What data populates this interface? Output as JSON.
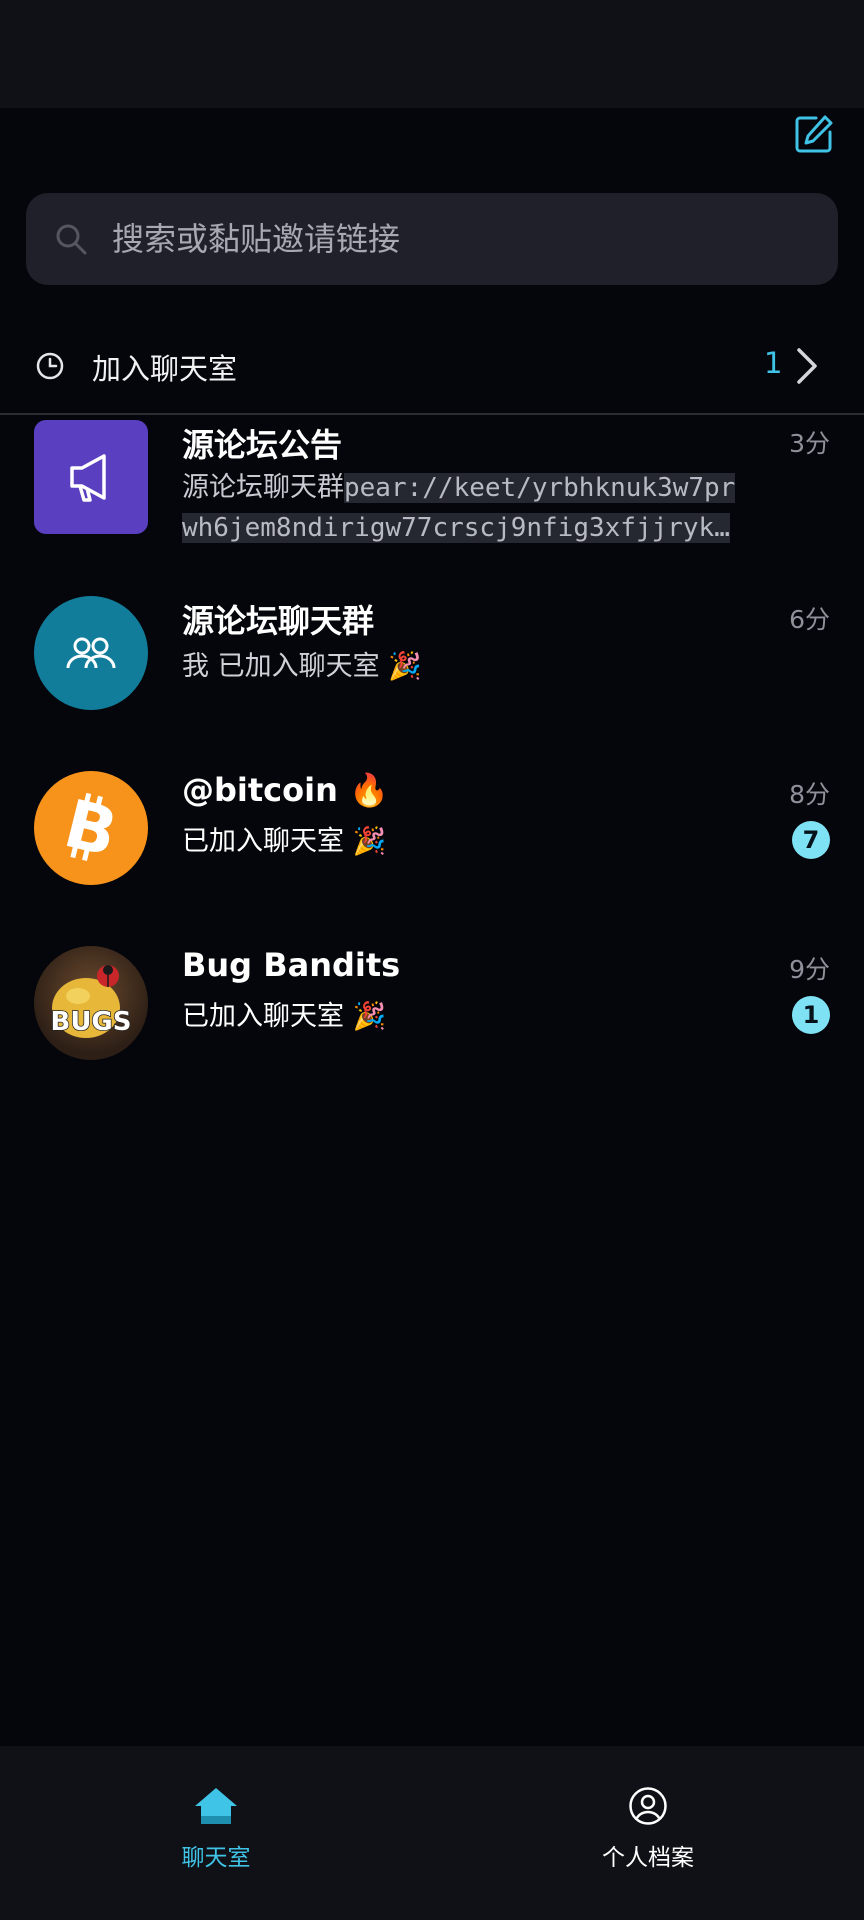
{
  "search": {
    "placeholder": "搜索或黏贴邀请链接"
  },
  "join_row": {
    "label": "加入聊天室",
    "count": "1"
  },
  "chats": [
    {
      "name": "源论坛公告",
      "time": "3分",
      "preview_prefix": "源论坛聊天群",
      "preview_link_line1": "pear://keet/yrbhknuk3w7pr",
      "preview_link_line2": "wh6jem8ndirigw77crscj9nfig3xfjjryk…",
      "avatar_icon": "megaphone-icon",
      "avatar_color": "#5a3fc0"
    },
    {
      "name": "源论坛聊天群",
      "time": "6分",
      "preview": "我 已加入聊天室 🎉",
      "avatar_icon": "group-icon",
      "avatar_color": "#127d9b"
    },
    {
      "name": "@bitcoin 🔥",
      "time": "8分",
      "preview": " 已加入聊天室 🎉",
      "badge": "7",
      "avatar_icon": "bitcoin-icon",
      "avatar_color": "#f7931a"
    },
    {
      "name": "Bug Bandits",
      "time": "9分",
      "preview": " 已加入聊天室 🎉",
      "badge": "1",
      "avatar_icon": "bugs-logo-icon",
      "avatar_text": "BUGS"
    }
  ],
  "nav": {
    "chats_label": "聊天室",
    "profile_label": "个人档案"
  },
  "colors": {
    "accent": "#3fc3e6",
    "badge": "#7fe2f4",
    "background": "#05060b"
  }
}
